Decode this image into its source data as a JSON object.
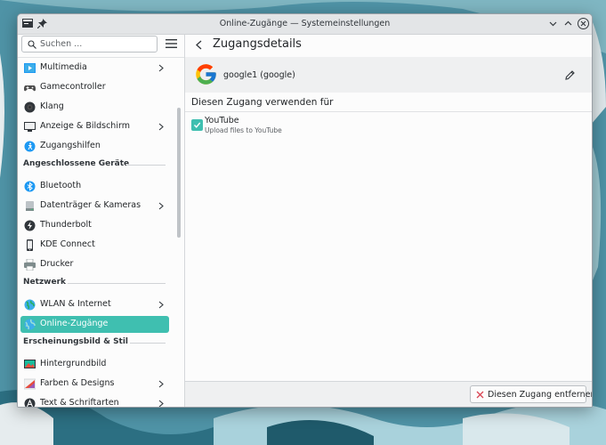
{
  "window": {
    "title": "Online-Zugänge — Systemeinstellungen"
  },
  "sidebar": {
    "search_placeholder": "Suchen ...",
    "items": [
      {
        "label": "Multimedia",
        "icon": "multimedia-icon",
        "chevron": true
      },
      {
        "label": "Gamecontroller",
        "icon": "gamepad-icon",
        "chevron": false
      },
      {
        "label": "Klang",
        "icon": "speaker-icon",
        "chevron": false
      },
      {
        "label": "Anzeige & Bildschirm",
        "icon": "monitor-icon",
        "chevron": true
      },
      {
        "label": "Zugangshilfen",
        "icon": "accessibility-icon",
        "chevron": false
      }
    ],
    "section_devices": "Angeschlossene Geräte",
    "devices": [
      {
        "label": "Bluetooth",
        "icon": "bluetooth-icon",
        "chevron": false
      },
      {
        "label": "Datenträger & Kameras",
        "icon": "drive-icon",
        "chevron": true
      },
      {
        "label": "Thunderbolt",
        "icon": "thunderbolt-icon",
        "chevron": false
      },
      {
        "label": "KDE Connect",
        "icon": "phone-icon",
        "chevron": false
      },
      {
        "label": "Drucker",
        "icon": "printer-icon",
        "chevron": false
      }
    ],
    "section_network": "Netzwerk",
    "network": [
      {
        "label": "WLAN & Internet",
        "icon": "globe-icon",
        "chevron": true
      },
      {
        "label": "Online-Zugänge",
        "icon": "online-accounts-icon",
        "chevron": false,
        "active": true
      }
    ],
    "section_appearance": "Erscheinungsbild & Stil",
    "appearance": [
      {
        "label": "Hintergrundbild",
        "icon": "wallpaper-icon",
        "chevron": false
      },
      {
        "label": "Farben & Designs",
        "icon": "palette-icon",
        "chevron": true
      },
      {
        "label": "Text & Schriftarten",
        "icon": "font-icon",
        "chevron": true
      }
    ]
  },
  "main": {
    "title": "Zugangsdetails",
    "account_name": "google1 (google)",
    "section_title": "Diesen Zugang verwenden für",
    "service": {
      "name": "YouTube",
      "description": "Upload files to YouTube",
      "checked": true
    },
    "remove_button": "Diesen Zugang entfernen"
  },
  "colors": {
    "accent": "#3fbfb0",
    "remove_icon": "#da4453"
  }
}
